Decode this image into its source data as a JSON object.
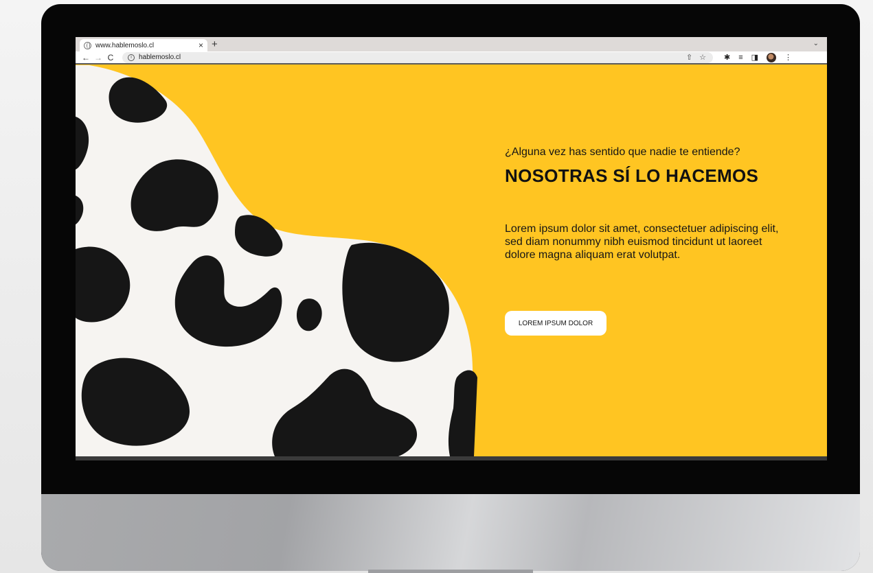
{
  "browser": {
    "tab_title": "www.hablemoslo.cl",
    "tab_close": "×",
    "new_tab": "+",
    "tab_menu": "⌄",
    "address": "hablemoslo.cl",
    "nav_back": "←",
    "nav_forward": "→",
    "nav_reload": "C",
    "share_icon": "⇧",
    "bookmark_icon": "☆",
    "ext_puzzle": "✱",
    "ext_queue": "≡",
    "ext_sidepanel": "◨",
    "menu_icon": "⋮"
  },
  "hero": {
    "eyebrow": "¿Alguna vez has sentido que nadie te entiende?",
    "headline": "NOSOTRAS SÍ LO HACEMOS",
    "body": "Lorem ipsum dolor sit amet, consectetuer adipiscing elit, sed diam nonummy nibh euismod tincidunt ut laoreet dolore magna aliquam erat volutpat.",
    "cta_label": "LOREM IPSUM DOLOR"
  },
  "colors": {
    "accent_yellow": "#ffc522",
    "cow_spot": "#161616",
    "cow_base": "#f6f4f1",
    "bezel": "#060606"
  }
}
